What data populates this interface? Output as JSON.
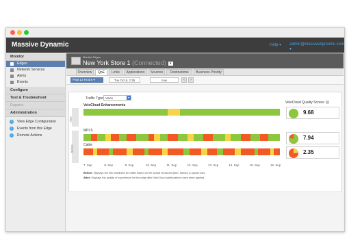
{
  "app": {
    "brand": "Massive Dynamic",
    "help_label": "Help",
    "user_label": "admin@massivedynamic.com"
  },
  "window": {
    "traffic_lights": [
      "#ff5f57",
      "#febc2e",
      "#28c840"
    ]
  },
  "sidebar": {
    "monitor_label": "Monitor",
    "monitor_items": [
      {
        "label": "Edges",
        "icon": "router-icon",
        "active": true
      },
      {
        "label": "Network Services",
        "icon": "network-icon",
        "active": false
      },
      {
        "label": "Alerts",
        "icon": "bell-icon",
        "active": false
      },
      {
        "label": "Events",
        "icon": "events-icon",
        "active": false
      }
    ],
    "configure_label": "Configure",
    "test_label": "Test & Troubleshoot",
    "reports_label": "Reports",
    "admin_label": "Administration",
    "action_links": [
      {
        "label": "View Edge Configuration",
        "icon": "arrow-right-icon"
      },
      {
        "label": "Events from this Edge",
        "icon": "arrow-right-icon"
      },
      {
        "label": "Remote Actions",
        "icon": "arrow-right-icon"
      }
    ]
  },
  "edge": {
    "subtitle": "Monitor Edges",
    "name": "New York Store 1",
    "status": "(Connected)"
  },
  "tabs": [
    {
      "label": "Overview",
      "active": false
    },
    {
      "label": "QoE",
      "active": true
    },
    {
      "label": "Links",
      "active": false
    },
    {
      "label": "Applications",
      "active": false
    },
    {
      "label": "Sources",
      "active": false
    },
    {
      "label": "Destinations",
      "active": false
    },
    {
      "label": "Business Priority",
      "active": false
    }
  ],
  "timebar": {
    "range": "Past 12 Hours",
    "start": "Tue Oct 6, 2:38",
    "end": "now"
  },
  "qoe": {
    "traffic_type_label": "Traffic Type:",
    "traffic_type_value": "Voice",
    "quality_scores_label": "VeloCloud Quality Scores",
    "after_label": "After",
    "before_label": "Before",
    "colors": {
      "good": "#8dc63f",
      "fair": "#f5d547",
      "poor": "#f15a24"
    },
    "lanes": [
      {
        "name": "VeloCloud Enhancements",
        "score": "9.68",
        "score_fraction": 0.968,
        "group": "after",
        "segments": [
          [
            "good",
            0,
            43
          ],
          [
            "fair",
            43,
            49
          ],
          [
            "good",
            49,
            100
          ]
        ]
      },
      {
        "name": "MPLS",
        "score": "7.94",
        "score_fraction": 0.794,
        "group": "before",
        "segments": [
          [
            "good",
            0,
            4
          ],
          [
            "poor",
            4,
            7
          ],
          [
            "good",
            7,
            11
          ],
          [
            "fair",
            11,
            14
          ],
          [
            "poor",
            14,
            18
          ],
          [
            "good",
            18,
            22
          ],
          [
            "poor",
            22,
            27
          ],
          [
            "good",
            27,
            33
          ],
          [
            "poor",
            33,
            36
          ],
          [
            "fair",
            36,
            39
          ],
          [
            "good",
            39,
            43
          ],
          [
            "poor",
            43,
            48
          ],
          [
            "good",
            48,
            53
          ],
          [
            "fair",
            53,
            56
          ],
          [
            "good",
            56,
            61
          ],
          [
            "poor",
            61,
            66
          ],
          [
            "good",
            66,
            72
          ],
          [
            "fair",
            72,
            75
          ],
          [
            "good",
            75,
            80
          ],
          [
            "poor",
            80,
            85
          ],
          [
            "good",
            85,
            90
          ],
          [
            "poor",
            90,
            94
          ],
          [
            "good",
            94,
            100
          ]
        ]
      },
      {
        "name": "Cable",
        "score": "2.35",
        "score_fraction": 0.235,
        "group": "before",
        "segments": [
          [
            "poor",
            0,
            5
          ],
          [
            "fair",
            5,
            7
          ],
          [
            "poor",
            7,
            13
          ],
          [
            "good",
            13,
            15
          ],
          [
            "poor",
            15,
            22
          ],
          [
            "fair",
            22,
            25
          ],
          [
            "poor",
            25,
            31
          ],
          [
            "good",
            31,
            33
          ],
          [
            "poor",
            33,
            40
          ],
          [
            "fair",
            40,
            43
          ],
          [
            "poor",
            43,
            51
          ],
          [
            "good",
            51,
            54
          ],
          [
            "poor",
            54,
            60
          ],
          [
            "fair",
            60,
            63
          ],
          [
            "poor",
            63,
            68
          ],
          [
            "good",
            68,
            71
          ],
          [
            "poor",
            71,
            77
          ],
          [
            "fair",
            77,
            80
          ],
          [
            "poor",
            80,
            87
          ],
          [
            "good",
            87,
            89
          ],
          [
            "poor",
            89,
            95
          ],
          [
            "fair",
            95,
            97
          ],
          [
            "poor",
            97,
            100
          ]
        ]
      }
    ],
    "x_ticks": [
      "7. Sep",
      "8. Sep",
      "9. Sep",
      "10. Sep",
      "11. Sep",
      "12. Sep",
      "13. Sep",
      "14. Sep",
      "15. Sep",
      "16. Sep"
    ],
    "note_before_label": "Before:",
    "note_before_text": "Displays the link readiness for traffic based on the actual measured jitter, latency & packet loss.",
    "note_after_label": "After:",
    "note_after_text": "Displays the quality of experience for this edge after VeloCloud optimizations have been applied."
  }
}
